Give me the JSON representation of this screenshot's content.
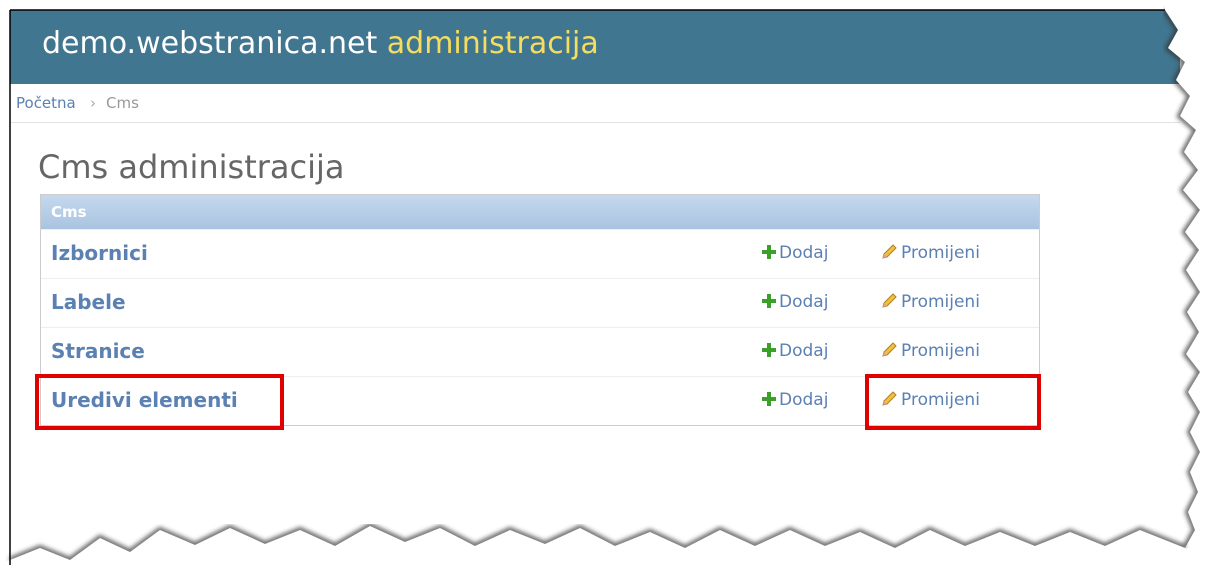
{
  "header": {
    "site_name": "demo.webstranica.net",
    "site_suffix": "administracija"
  },
  "breadcrumbs": {
    "home": "Početna",
    "separator": "›",
    "current": "Cms"
  },
  "page": {
    "title": "Cms administracija"
  },
  "module": {
    "caption": "Cms",
    "rows": [
      {
        "name": "Izbornici",
        "add_label": "Dodaj",
        "change_label": "Promijeni"
      },
      {
        "name": "Labele",
        "add_label": "Dodaj",
        "change_label": "Promijeni"
      },
      {
        "name": "Stranice",
        "add_label": "Dodaj",
        "change_label": "Promijeni"
      },
      {
        "name": "Uredivi elementi",
        "add_label": "Dodaj",
        "change_label": "Promijeni"
      }
    ]
  },
  "colors": {
    "header_bg": "#417690",
    "header_accent": "#f5dd5d",
    "link": "#5b80b2",
    "highlight": "#e00000",
    "add_icon": "#3aa02a",
    "change_icon": "#e0b020"
  },
  "icons": {
    "add": "plus-icon",
    "change": "pencil-icon"
  }
}
